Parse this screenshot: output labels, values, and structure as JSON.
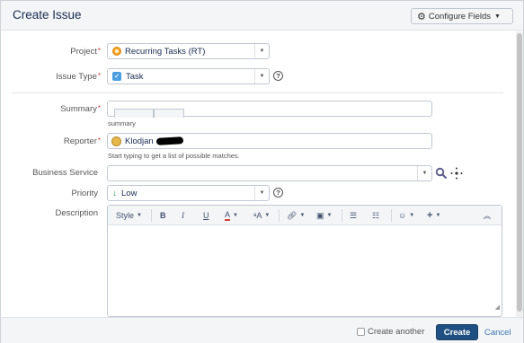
{
  "dialog": {
    "title": "Create Issue",
    "configure_fields": "Configure Fields"
  },
  "fields": {
    "project": {
      "label": "Project",
      "value": "Recurring Tasks (RT)"
    },
    "issue_type": {
      "label": "Issue Type",
      "value": "Task"
    },
    "summary": {
      "label": "Summary",
      "value": "",
      "hint": "summary"
    },
    "reporter": {
      "label": "Reporter",
      "value": "Klodjan",
      "hint": "Start typing to get a list of possible matches."
    },
    "business_service": {
      "label": "Business Service",
      "value": ""
    },
    "priority": {
      "label": "Priority",
      "value": "Low"
    },
    "description": {
      "label": "Description"
    }
  },
  "editor_toolbar": {
    "style": "Style",
    "bold": "B",
    "italic": "I",
    "underline": "U",
    "text_color": "A",
    "text_size": "ᵃA"
  },
  "footer": {
    "create_another": "Create another",
    "create": "Create",
    "cancel": "Cancel"
  },
  "colors": {
    "primary_button": "#205081",
    "required": "#d04437",
    "link": "#3b73af"
  }
}
